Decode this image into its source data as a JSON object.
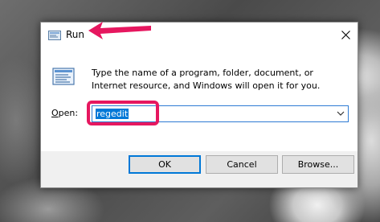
{
  "window": {
    "title": "Run",
    "close_glyph": "✕"
  },
  "body": {
    "description": "Type the name of a program, folder, document, or Internet resource, and Windows will open it for you.",
    "open_label_prefix": "O",
    "open_label_rest": "pen:",
    "open_value": "regedit"
  },
  "buttons": {
    "ok": "OK",
    "cancel": "Cancel",
    "browse": "Browse..."
  },
  "icons": {
    "title_icon": "run-icon",
    "body_icon": "run-icon",
    "close": "close-icon",
    "dropdown": "chevron-down-icon"
  },
  "colors": {
    "accent": "#0078d7",
    "annotation": "#e6175f",
    "dialog_bg": "#f0f0f0"
  }
}
